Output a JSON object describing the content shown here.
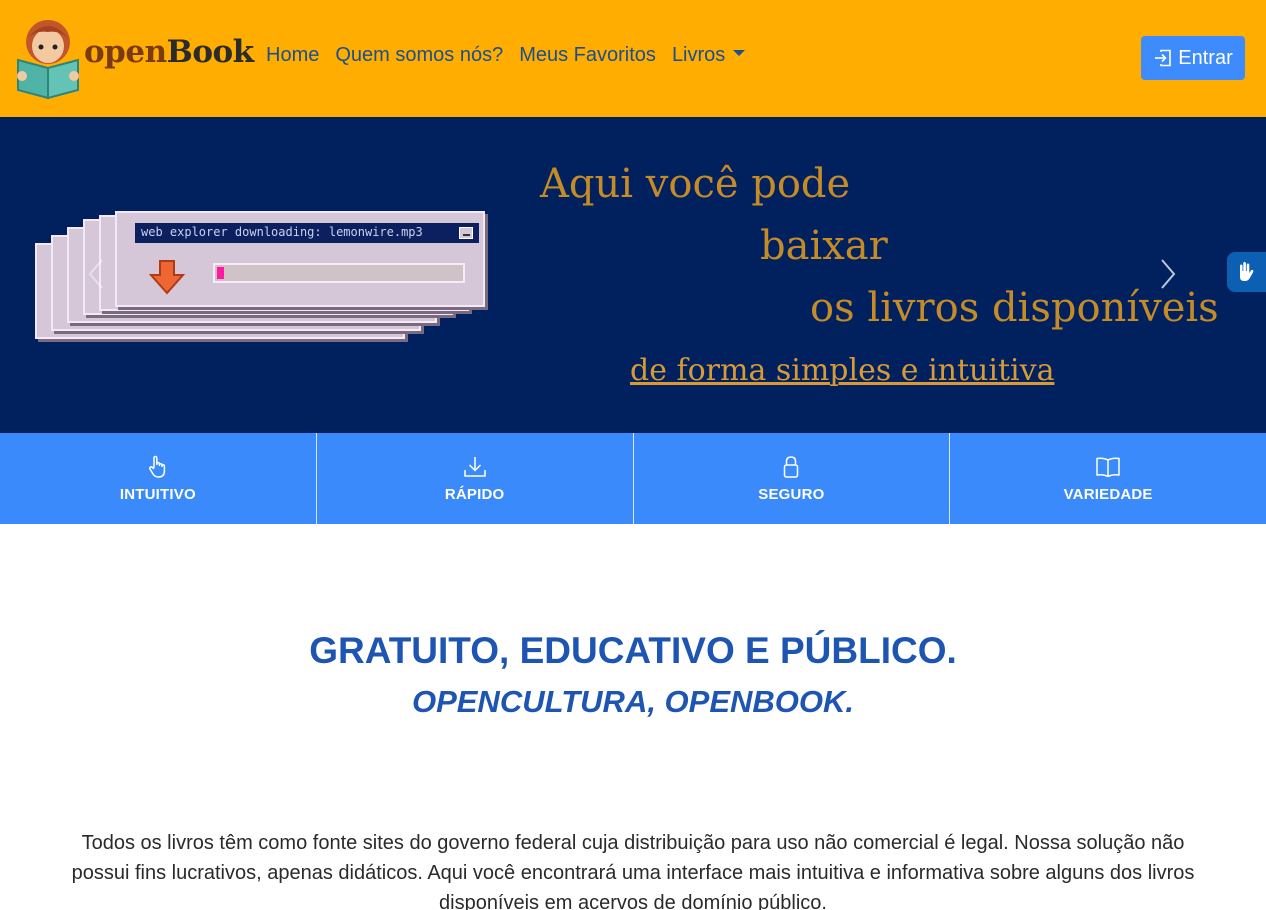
{
  "brand": {
    "name_open": "open",
    "name_book": "Book"
  },
  "nav": {
    "links": [
      "Home",
      "Quem somos nós?",
      "Meus Favoritos",
      "Livros"
    ],
    "login_label": "Entrar"
  },
  "hero": {
    "line1": "Aqui você pode",
    "line2": "baixar",
    "line3": "os livros disponíveis",
    "line4": "de forma simples e intuitiva",
    "window_title": "web explorer downloading: lemonwire.mp3",
    "download_progress": 0.03
  },
  "features": [
    {
      "label": "INTUITIVO",
      "icon": "hand-pointer-icon"
    },
    {
      "label": "RÁPIDO",
      "icon": "download-icon"
    },
    {
      "label": "SEGURO",
      "icon": "lock-icon"
    },
    {
      "label": "VARIEDADE",
      "icon": "book-open-icon"
    }
  ],
  "content": {
    "headline": "GRATUITO, EDUCATIVO E PÚBLICO.",
    "subline": "OPENCULTURA, OPENBOOK.",
    "paragraph": "Todos os livros têm como fonte sites do governo federal cuja distribuição para uso não comercial é legal. Nossa solução não possui fins lucrativos, apenas didáticos. Aqui você encontrará uma interface mais intuitiva e informativa sobre alguns dos livros disponíveis em acervos de domínio público."
  },
  "colors": {
    "navbar": "#ffad00",
    "hero_bg": "#00205e",
    "hero_text": "#c58b27",
    "feature_bg": "#3b8afc",
    "headline": "#1e55b3",
    "button": "#3d8bfd"
  }
}
